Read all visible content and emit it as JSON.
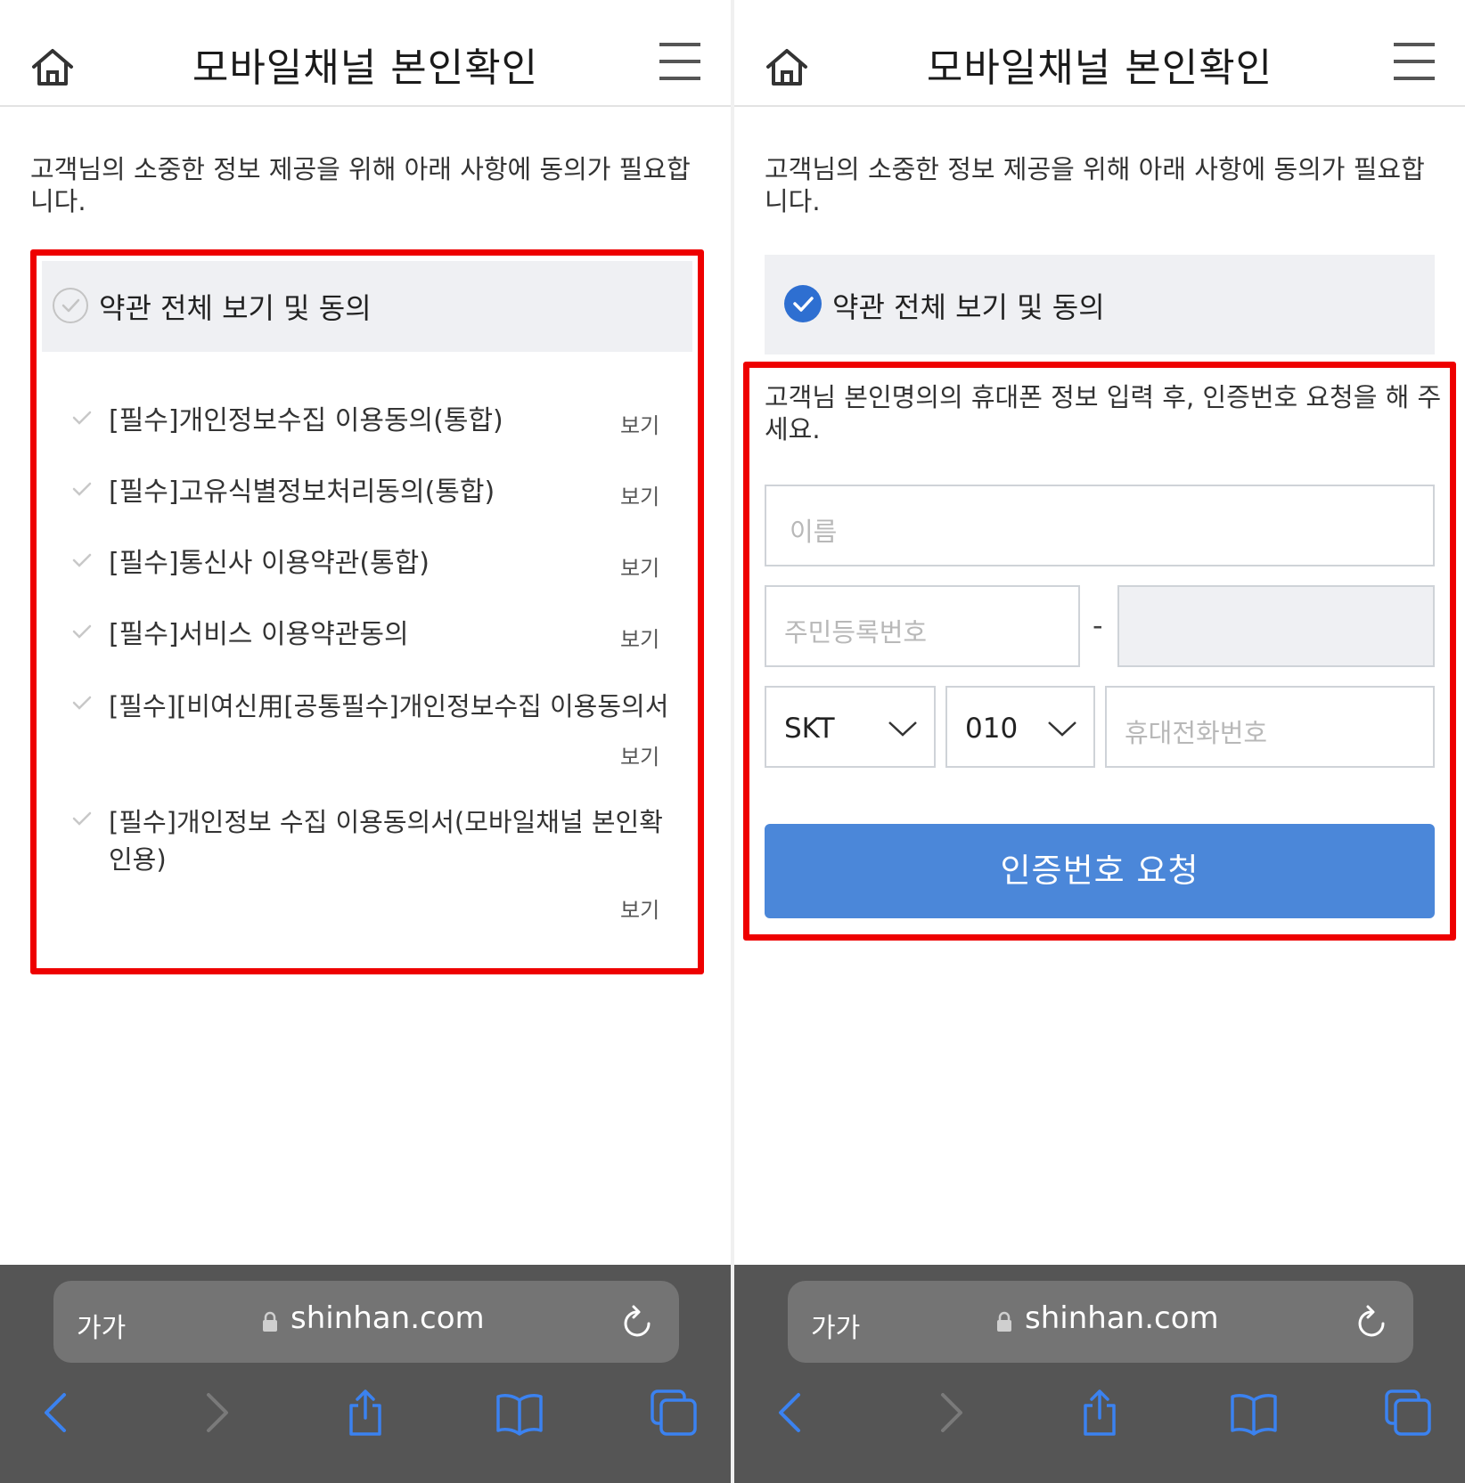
{
  "screen_left": {
    "title": "모바일채널 본인확인",
    "intro": "고객님의 소중한 정보 제공을 위해 아래 사항에 동의가 필요합니다.",
    "agree_all": {
      "label": "약관 전체 보기 및 동의",
      "checked": false
    },
    "terms": [
      {
        "label": "[필수]개인정보수집 이용동의(통합)",
        "view": "보기"
      },
      {
        "label": "[필수]고유식별정보처리동의(통합)",
        "view": "보기"
      },
      {
        "label": "[필수]통신사 이용약관(통합)",
        "view": "보기"
      },
      {
        "label": "[필수]서비스 이용약관동의",
        "view": "보기"
      },
      {
        "label": "[필수][비여신用[공통필수]개인정보수집 이용동의서",
        "view": "보기"
      },
      {
        "label": "[필수]개인정보 수집 이용동의서(모바일채널 본인확인용)",
        "view": "보기"
      }
    ],
    "browser": {
      "aa": "가가",
      "url": "shinhan.com"
    }
  },
  "screen_right": {
    "title": "모바일채널 본인확인",
    "intro": "고객님의 소중한 정보 제공을 위해 아래 사항에 동의가 필요합니다.",
    "agree_all": {
      "label": "약관 전체 보기 및 동의",
      "checked": true
    },
    "instruction": "고객님 본인명의의  휴대폰 정보 입력 후, 인증번호 요청을 해 주세요.",
    "form": {
      "name_placeholder": "이름",
      "rrn_placeholder": "주민등록번호",
      "rrn_separator": "-",
      "carrier": "SKT",
      "prefix": "010",
      "phone_placeholder": "휴대전화번호"
    },
    "submit_label": "인증번호 요청",
    "browser": {
      "aa": "가가",
      "url": "shinhan.com"
    }
  },
  "colors": {
    "highlight_red": "#ee0000",
    "primary_blue": "#4b87d9",
    "check_blue": "#2e6fd1",
    "toolbar_icon_blue": "#3b82f0"
  },
  "icons": [
    "home-icon",
    "menu-icon",
    "check-circle-icon",
    "check-icon",
    "chevron-down-icon",
    "lock-icon",
    "reload-icon",
    "back-icon",
    "forward-icon",
    "share-icon",
    "bookmarks-icon",
    "tabs-icon"
  ]
}
